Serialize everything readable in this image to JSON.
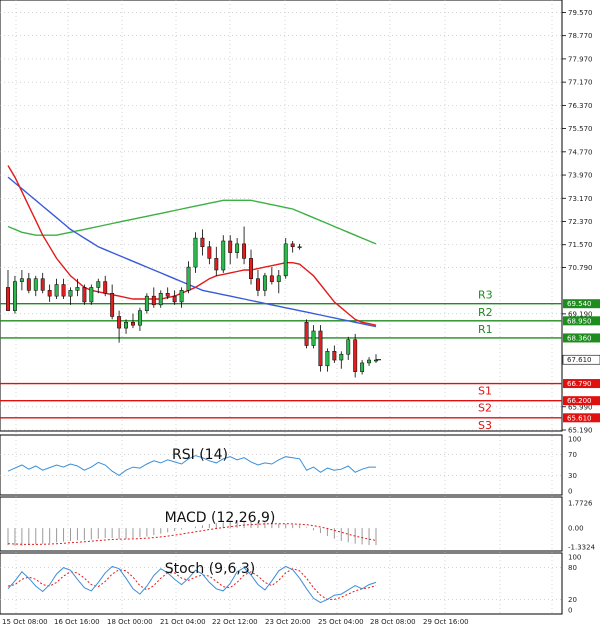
{
  "chart_data": {
    "type": "candlestick",
    "price_axis_ticks": [
      "79.570",
      "78.770",
      "77.970",
      "77.170",
      "76.370",
      "75.570",
      "74.770",
      "73.970",
      "73.170",
      "72.370",
      "71.570",
      "70.790",
      "69.190",
      "65.990",
      "65.190"
    ],
    "price_ylim": [
      65.19,
      79.93
    ],
    "date_ticks": [
      "15 Oct 08:00",
      "16 Oct 16:00",
      "18 Oct 00:00",
      "21 Oct 04:00",
      "22 Oct 12:00",
      "23 Oct 20:00",
      "25 Oct 04:00",
      "28 Oct 08:00",
      "29 Oct 16:00"
    ],
    "last_price": "67.610",
    "levels": [
      {
        "name": "R3",
        "value": "69.540",
        "color": "#1e8c1e"
      },
      {
        "name": "R2",
        "value": "68.950",
        "color": "#1e8c1e"
      },
      {
        "name": "R1",
        "value": "68.360",
        "color": "#1e8c1e"
      },
      {
        "name": "S1",
        "value": "66.790",
        "color": "#e01010"
      },
      {
        "name": "S2",
        "value": "66.200",
        "color": "#e01010"
      },
      {
        "name": "S3",
        "value": "65.610",
        "color": "#e01010"
      }
    ],
    "candles": [
      [
        70.1,
        70.7,
        69.3,
        69.3
      ],
      [
        69.3,
        70.5,
        69.2,
        70.3
      ],
      [
        70.3,
        70.7,
        70.0,
        70.4
      ],
      [
        70.4,
        70.6,
        69.9,
        70.0
      ],
      [
        70.0,
        70.5,
        69.8,
        70.4
      ],
      [
        70.4,
        70.6,
        69.9,
        70.0
      ],
      [
        70.0,
        70.2,
        69.6,
        69.8
      ],
      [
        69.8,
        70.4,
        69.7,
        70.2
      ],
      [
        70.2,
        70.4,
        69.7,
        69.8
      ],
      [
        69.8,
        70.1,
        69.5,
        70.0
      ],
      [
        70.0,
        70.4,
        69.8,
        70.1
      ],
      [
        70.1,
        70.2,
        69.5,
        69.6
      ],
      [
        69.6,
        70.2,
        69.5,
        70.1
      ],
      [
        70.1,
        70.4,
        69.9,
        70.3
      ],
      [
        70.3,
        70.5,
        69.8,
        69.9
      ],
      [
        69.9,
        70.2,
        69.0,
        69.1
      ],
      [
        69.1,
        69.3,
        68.2,
        68.7
      ],
      [
        68.7,
        69.0,
        68.5,
        68.9
      ],
      [
        68.9,
        69.2,
        68.7,
        68.8
      ],
      [
        68.8,
        69.4,
        68.6,
        69.3
      ],
      [
        69.3,
        69.9,
        69.2,
        69.8
      ],
      [
        69.8,
        70.1,
        69.4,
        69.5
      ],
      [
        69.5,
        70.0,
        69.4,
        69.9
      ],
      [
        69.9,
        70.1,
        69.7,
        69.8
      ],
      [
        69.8,
        70.0,
        69.5,
        69.6
      ],
      [
        69.6,
        70.1,
        69.4,
        70.0
      ],
      [
        70.0,
        71.0,
        69.9,
        70.8
      ],
      [
        70.8,
        72.0,
        70.6,
        71.8
      ],
      [
        71.8,
        72.1,
        71.2,
        71.5
      ],
      [
        71.5,
        71.7,
        70.9,
        71.1
      ],
      [
        71.1,
        71.5,
        70.5,
        70.7
      ],
      [
        70.7,
        71.9,
        70.6,
        71.7
      ],
      [
        71.7,
        71.9,
        70.9,
        71.3
      ],
      [
        71.3,
        71.8,
        71.1,
        71.6
      ],
      [
        71.6,
        72.2,
        70.9,
        71.1
      ],
      [
        71.1,
        71.4,
        70.2,
        70.4
      ],
      [
        70.4,
        70.7,
        69.8,
        70.0
      ],
      [
        70.0,
        70.6,
        69.8,
        70.5
      ],
      [
        70.5,
        70.8,
        70.2,
        70.3
      ],
      [
        70.3,
        70.7,
        69.9,
        70.5
      ],
      [
        70.5,
        71.8,
        70.4,
        71.6
      ],
      [
        71.6,
        71.7,
        71.3,
        71.5
      ],
      [
        71.5,
        71.6,
        71.4,
        71.5
      ],
      [
        68.9,
        69.0,
        68.0,
        68.1
      ],
      [
        68.1,
        68.8,
        68.0,
        68.6
      ],
      [
        68.6,
        68.8,
        67.2,
        67.4
      ],
      [
        67.4,
        68.0,
        67.2,
        67.9
      ],
      [
        67.9,
        68.1,
        67.5,
        67.6
      ],
      [
        67.6,
        67.9,
        67.3,
        67.8
      ],
      [
        67.8,
        68.4,
        67.6,
        68.3
      ],
      [
        68.3,
        68.5,
        67.0,
        67.2
      ],
      [
        67.2,
        67.6,
        67.1,
        67.5
      ],
      [
        67.5,
        67.7,
        67.4,
        67.6
      ],
      [
        67.6,
        67.8,
        67.5,
        67.6
      ]
    ],
    "sma_red": [
      74.3,
      73.9,
      73.4,
      72.9,
      72.4,
      71.9,
      71.5,
      71.1,
      70.8,
      70.5,
      70.3,
      70.1,
      70.0,
      69.95,
      69.9,
      69.85,
      69.8,
      69.75,
      69.7,
      69.7,
      69.7,
      69.7,
      69.7,
      69.75,
      69.8,
      69.9,
      70.0,
      70.1,
      70.25,
      70.4,
      70.5,
      70.55,
      70.6,
      70.65,
      70.7,
      70.7,
      70.75,
      70.8,
      70.85,
      70.9,
      70.95,
      70.95,
      70.9,
      70.7,
      70.5,
      70.2,
      69.9,
      69.6,
      69.4,
      69.2,
      69.0,
      68.9,
      68.85,
      68.8
    ],
    "sma_blue": [
      73.9,
      73.7,
      73.5,
      73.3,
      73.1,
      72.9,
      72.7,
      72.5,
      72.3,
      72.1,
      71.95,
      71.8,
      71.65,
      71.5,
      71.4,
      71.3,
      71.2,
      71.1,
      71.0,
      70.9,
      70.8,
      70.7,
      70.6,
      70.5,
      70.4,
      70.3,
      70.2,
      70.1,
      70.0,
      69.95,
      69.9,
      69.85,
      69.8,
      69.75,
      69.7,
      69.65,
      69.6,
      69.55,
      69.5,
      69.45,
      69.4,
      69.35,
      69.3,
      69.25,
      69.2,
      69.15,
      69.1,
      69.05,
      69.0,
      68.95,
      68.9,
      68.85,
      68.8,
      68.75
    ],
    "sma_green": [
      72.2,
      72.1,
      72.0,
      71.95,
      71.9,
      71.9,
      71.9,
      71.9,
      71.95,
      72.0,
      72.05,
      72.1,
      72.15,
      72.2,
      72.25,
      72.3,
      72.35,
      72.4,
      72.45,
      72.5,
      72.55,
      72.6,
      72.65,
      72.7,
      72.75,
      72.8,
      72.85,
      72.9,
      72.95,
      73.0,
      73.05,
      73.1,
      73.1,
      73.1,
      73.1,
      73.1,
      73.05,
      73.0,
      72.95,
      72.9,
      72.85,
      72.8,
      72.7,
      72.6,
      72.5,
      72.4,
      72.3,
      72.2,
      72.1,
      72.0,
      71.9,
      71.8,
      71.7,
      71.6
    ],
    "rsi": {
      "title": "RSI (14)",
      "ticks": [
        "100",
        "70",
        "30",
        "0"
      ],
      "values": [
        38,
        44,
        50,
        42,
        48,
        40,
        45,
        50,
        46,
        52,
        48,
        40,
        46,
        55,
        50,
        38,
        30,
        40,
        46,
        44,
        52,
        58,
        54,
        60,
        56,
        52,
        62,
        68,
        64,
        58,
        54,
        62,
        66,
        60,
        64,
        56,
        50,
        54,
        52,
        60,
        66,
        64,
        62,
        40,
        46,
        36,
        44,
        40,
        42,
        48,
        36,
        42,
        46,
        46
      ]
    },
    "macd": {
      "title": "MACD (12,26,9)",
      "ticks": [
        "1.7726",
        "0.00",
        "-1.3324"
      ],
      "values": [
        -1.2,
        -1.25,
        -1.25,
        -1.2,
        -1.15,
        -1.1,
        -1.05,
        -1.0,
        -0.95,
        -0.9,
        -0.85,
        -0.85,
        -0.8,
        -0.75,
        -0.7,
        -0.7,
        -0.75,
        -0.75,
        -0.7,
        -0.65,
        -0.6,
        -0.5,
        -0.4,
        -0.3,
        -0.2,
        -0.1,
        0.0,
        0.1,
        0.2,
        0.3,
        0.35,
        0.4,
        0.45,
        0.5,
        0.5,
        0.5,
        0.45,
        0.4,
        0.35,
        0.3,
        0.3,
        0.25,
        0.2,
        0.05,
        -0.15,
        -0.35,
        -0.55,
        -0.75,
        -0.9,
        -1.0,
        -1.1,
        -1.15,
        -1.2,
        -1.2
      ],
      "signal": [
        -1.1,
        -1.12,
        -1.14,
        -1.15,
        -1.15,
        -1.14,
        -1.12,
        -1.1,
        -1.07,
        -1.03,
        -1.0,
        -0.96,
        -0.92,
        -0.88,
        -0.84,
        -0.8,
        -0.78,
        -0.77,
        -0.76,
        -0.74,
        -0.71,
        -0.67,
        -0.62,
        -0.56,
        -0.49,
        -0.42,
        -0.34,
        -0.26,
        -0.18,
        -0.1,
        -0.03,
        0.04,
        0.1,
        0.16,
        0.21,
        0.25,
        0.28,
        0.3,
        0.31,
        0.31,
        0.31,
        0.3,
        0.28,
        0.24,
        0.17,
        0.08,
        -0.03,
        -0.16,
        -0.29,
        -0.43,
        -0.56,
        -0.67,
        -0.78,
        -0.87
      ]
    },
    "stoch": {
      "title": "Stoch (9,6,3)",
      "ticks": [
        "100",
        "80",
        "20",
        "0"
      ],
      "k": [
        40,
        55,
        72,
        60,
        45,
        35,
        48,
        68,
        80,
        75,
        58,
        42,
        36,
        52,
        70,
        82,
        78,
        60,
        40,
        30,
        45,
        65,
        78,
        70,
        58,
        48,
        60,
        75,
        68,
        52,
        40,
        36,
        50,
        72,
        80,
        66,
        48,
        38,
        55,
        74,
        82,
        76,
        60,
        40,
        22,
        14,
        20,
        28,
        30,
        38,
        46,
        40,
        48,
        52
      ],
      "d": [
        45,
        48,
        58,
        62,
        58,
        48,
        45,
        52,
        64,
        72,
        70,
        60,
        48,
        44,
        54,
        68,
        76,
        74,
        62,
        46,
        38,
        46,
        60,
        70,
        70,
        60,
        56,
        62,
        66,
        64,
        54,
        44,
        42,
        52,
        66,
        72,
        64,
        52,
        46,
        56,
        70,
        78,
        74,
        60,
        42,
        28,
        20,
        20,
        24,
        30,
        36,
        40,
        42,
        46
      ]
    }
  }
}
